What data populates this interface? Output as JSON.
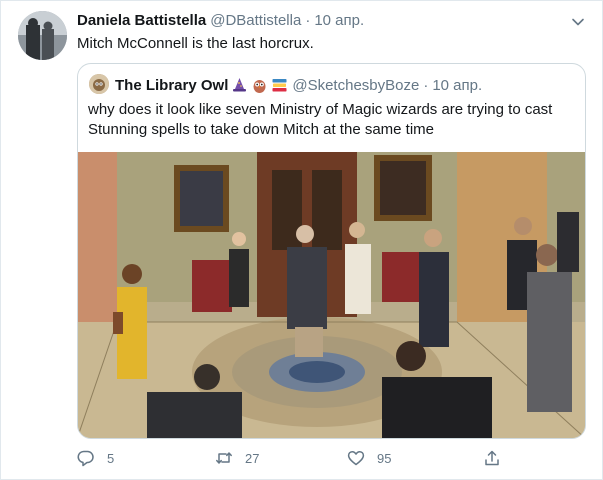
{
  "tweet": {
    "author": {
      "display_name": "Daniela Battistella",
      "handle": "@DBattistella",
      "date": "10 апр."
    },
    "separator": "·",
    "text": "Mitch McConnell is the last horcrux.",
    "menu_icon": "chevron-down-icon"
  },
  "quoted": {
    "author": {
      "display_name": "The Library Owl",
      "handle": "@SketchesbyBoze",
      "date": "10 апр."
    },
    "separator": "·",
    "emojis": [
      "wizard-emoji",
      "owl-emoji",
      "books-emoji"
    ],
    "text": "why does it look like seven Ministry of Magic wizards are trying to cast Stunning spells to take down Mitch at the same time"
  },
  "actions": {
    "reply": {
      "icon": "reply-icon",
      "count": "5"
    },
    "retweet": {
      "icon": "retweet-icon",
      "count": "27"
    },
    "like": {
      "icon": "heart-icon",
      "count": "95"
    },
    "share": {
      "icon": "share-icon",
      "count": ""
    }
  },
  "colors": {
    "text": "#14171a",
    "muted": "#657786",
    "border": "#cfd9de"
  }
}
